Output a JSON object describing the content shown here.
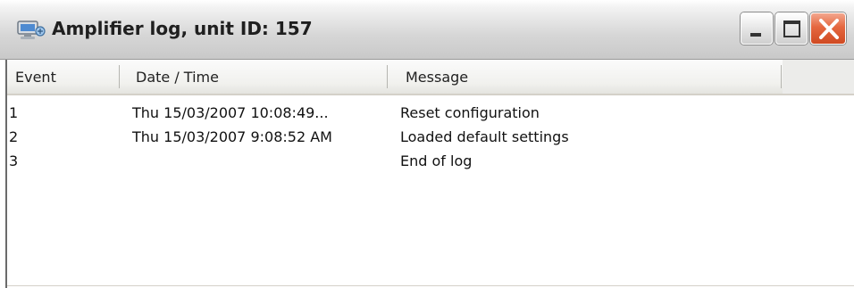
{
  "window": {
    "title": "Amplifier log, unit ID: 157",
    "icon": "amplifier-app-icon",
    "controls": {
      "minimize": "minimize-icon",
      "maximize": "maximize-icon",
      "close": "close-icon",
      "close_color": "#d9532c"
    }
  },
  "table": {
    "columns": [
      "Event",
      "Date / Time",
      "Message"
    ],
    "rows": [
      {
        "event": "1",
        "datetime": "Thu 15/03/2007 10:08:49...",
        "message": "Reset configuration"
      },
      {
        "event": "2",
        "datetime": "Thu 15/03/2007 9:08:52 AM",
        "message": "Loaded default settings"
      },
      {
        "event": "3",
        "datetime": "",
        "message": "End of log"
      }
    ]
  }
}
